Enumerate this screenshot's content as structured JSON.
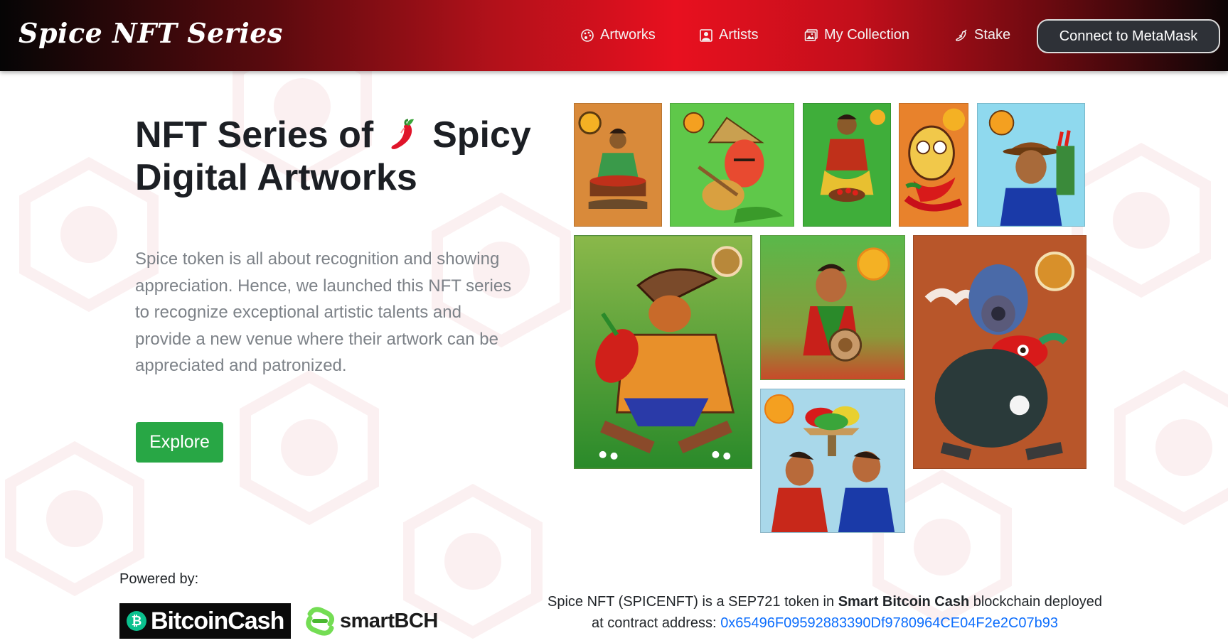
{
  "navbar": {
    "brand": "Spice NFT Series",
    "items": [
      {
        "label": "Artworks",
        "icon": "palette-icon"
      },
      {
        "label": "Artists",
        "icon": "person-badge-icon"
      },
      {
        "label": "My Collection",
        "icon": "images-icon"
      },
      {
        "label": "Stake",
        "icon": "pepper-icon"
      }
    ],
    "connect_label": "Connect to MetaMask"
  },
  "hero": {
    "title_part1": "NFT Series of",
    "title_emoji": "chili-pepper-icon",
    "title_part2": "Spicy Digital Artworks",
    "description": "Spice token is all about recognition and showing appreciation. Hence, we launched this NFT series to recognize exceptional artistic talents and provide a new venue where their artwork can be appreciated and patronized.",
    "explore_label": "Explore"
  },
  "gallery": {
    "artworks": [
      {
        "name": "woman-with-chili-basket",
        "bg": "#d98a3a"
      },
      {
        "name": "farmer-with-guitar",
        "bg": "#5fc84a"
      },
      {
        "name": "woman-squatting-with-chilis",
        "bg": "#3fae3a"
      },
      {
        "name": "skull-with-chilis",
        "bg": "#e8822c"
      },
      {
        "name": "farmer-with-hat-blue",
        "bg": "#8fd9ee"
      },
      {
        "name": "farmer-holding-chili",
        "bg": "#5aa040"
      },
      {
        "name": "boy-with-bowl",
        "bg": "#66b84a"
      },
      {
        "name": "elephant-god-with-chili",
        "bg": "#b8562a"
      },
      {
        "name": "couple-with-chili-platter",
        "bg": "#a9d8ea"
      }
    ]
  },
  "footer": {
    "powered_label": "Powered by:",
    "bch_logo_text": "BitcoinCash",
    "sbch_logo_text": "smartBCH",
    "contract_text_1": "Spice NFT (SPICENFT) is a SEP721 token in",
    "contract_bold": "Smart Bitcoin Cash",
    "contract_text_2": "blockchain deployed at contract address:",
    "contract_address": "0x65496F09592883390Df9780964CE04F2e2C07b93"
  },
  "colors": {
    "accent_red": "#e8101f",
    "explore_green": "#28a745",
    "link_blue": "#0d6efd"
  }
}
